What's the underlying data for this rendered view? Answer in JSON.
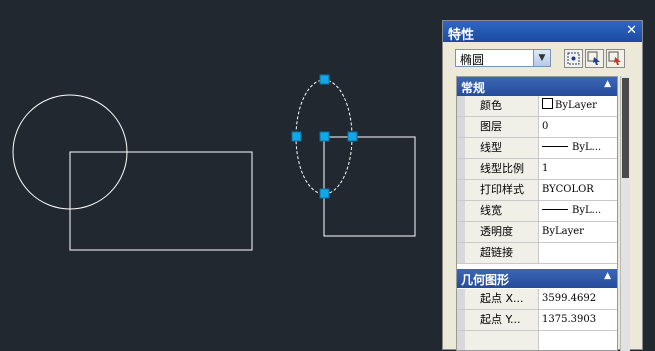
{
  "properties_panel": {
    "title": "特性",
    "close_label": "✕",
    "object_type": "椭圆",
    "dropdown_glyph": "▼",
    "collapse_glyph": "▲",
    "sections": [
      {
        "label": "常规",
        "rows": [
          {
            "key": "颜色",
            "value": "ByLayer",
            "swatch": true
          },
          {
            "key": "图层",
            "value": "0"
          },
          {
            "key": "线型",
            "value": "ByL...",
            "line": true
          },
          {
            "key": "线型比例",
            "value": "1"
          },
          {
            "key": "打印样式",
            "value": "BYCOLOR"
          },
          {
            "key": "线宽",
            "value": "ByL...",
            "line": true
          },
          {
            "key": "透明度",
            "value": "ByLayer"
          },
          {
            "key": "超链接",
            "value": ""
          }
        ]
      },
      {
        "label": "几何图形",
        "rows": [
          {
            "key": "起点 X...",
            "value": "3599.4692"
          },
          {
            "key": "起点 Y...",
            "value": "1375.3903"
          }
        ]
      }
    ],
    "toolbar_icons": [
      "quick-select-icon",
      "select-objects-icon",
      "toggle-pickadd-icon"
    ]
  },
  "colors": {
    "canvas_bg": "#212830",
    "entity_line": "#ffffff",
    "grip": "#12a8e8",
    "section_header": "#2f5aa8"
  }
}
